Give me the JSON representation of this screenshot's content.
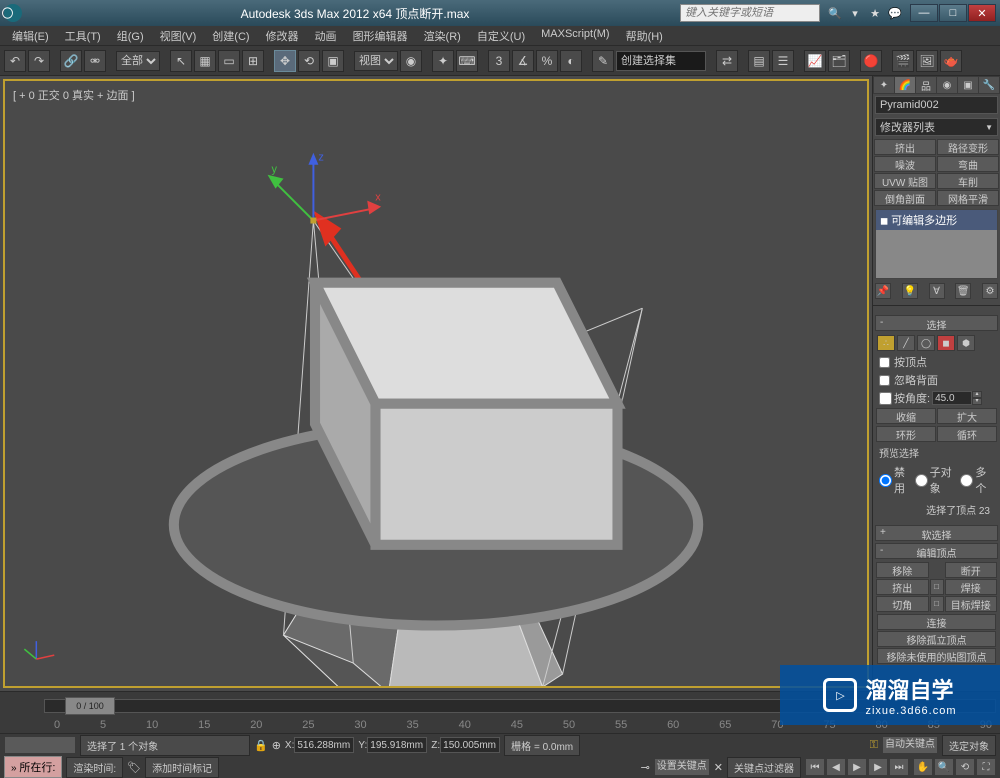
{
  "title": "Autodesk 3ds Max  2012 x64      顶点断开.max",
  "search_placeholder": "键入关键字或短语",
  "menu": [
    "编辑(E)",
    "工具(T)",
    "组(G)",
    "视图(V)",
    "创建(C)",
    "修改器",
    "动画",
    "图形编辑器",
    "渲染(R)",
    "自定义(U)",
    "MAXScript(M)",
    "帮助(H)"
  ],
  "toolbar": {
    "scope": "全部",
    "viewmode": "视图",
    "selectset": "创建选择集"
  },
  "viewport": {
    "label": "[ + 0 正交 0 真实 + 边面 ]"
  },
  "right": {
    "obj_name": "Pyramid002",
    "mod_list_label": "修改器列表",
    "mod_buttons": [
      "挤出",
      "路径变形",
      "噪波",
      "弯曲",
      "UVW 贴图",
      "车削",
      "倒角剖面",
      "网格平滑"
    ],
    "stack_item": "可编辑多边形",
    "rollouts": {
      "select": "选择",
      "by_vertex": "按顶点",
      "ignore_backface": "忽略背面",
      "by_angle": "按角度:",
      "angle_value": "45.0",
      "shrink": "收缩",
      "grow": "扩大",
      "ring": "环形",
      "loop": "循环",
      "preview_sel": "预览选择",
      "disable": "禁用",
      "subobj": "子对象",
      "multi": "多个",
      "sel_count": "选择了顶点 23",
      "soft_sel": "软选择",
      "edit_vert": "编辑顶点",
      "remove": "移除",
      "break": "断开",
      "extrude": "挤出",
      "weld": "焊接",
      "chamfer": "切角",
      "target_weld": "目标焊接",
      "connect": "连接",
      "remove_iso": "移除孤立顶点",
      "remove_unused": "移除未使用的贴图顶点"
    }
  },
  "timeline": {
    "frame": "0 / 100",
    "marks": [
      "0",
      "5",
      "10",
      "15",
      "20",
      "25",
      "30",
      "35",
      "40",
      "45",
      "50",
      "55",
      "60",
      "65",
      "70",
      "75",
      "80",
      "85",
      "90"
    ]
  },
  "status": {
    "sel_info": "选择了 1 个对象",
    "x": "516.288mm",
    "y": "195.918mm",
    "z": "150.005mm",
    "grid": "栅格 = 0.0mm",
    "autokey": "自动关键点",
    "selkey_label": "选定对象",
    "setkey": "设置关键点",
    "keyfilter": "关键点过滤器",
    "script_label": "所在行:",
    "render_time": "渲染时间:",
    "add_marker": "添加时间标记"
  },
  "watermark": {
    "cn": "溜溜自学",
    "url": "zixue.3d66.com"
  }
}
